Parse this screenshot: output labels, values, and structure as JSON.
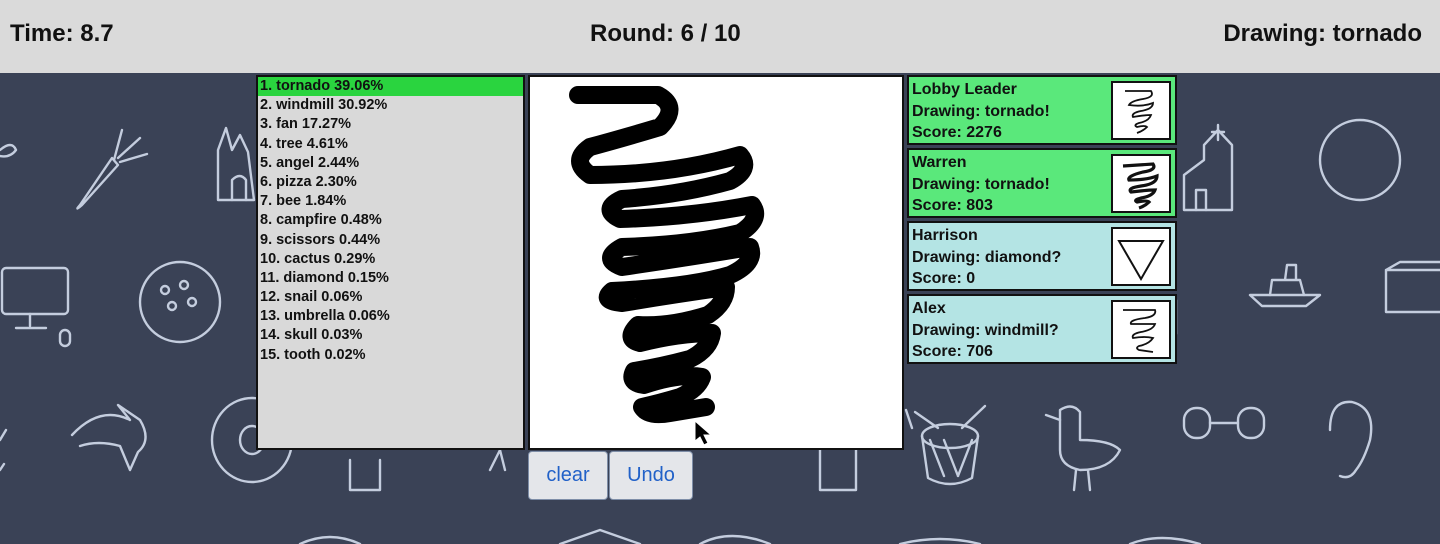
{
  "header": {
    "time_label": "Time: 8.7",
    "round_label": "Round: 6 / 10",
    "drawing_label": "Drawing: tornado"
  },
  "predictions": [
    "1. tornado 39.06%",
    "2. windmill 30.92%",
    "3. fan 17.27%",
    "4. tree 4.61%",
    "5. angel 2.44%",
    "6. pizza 2.30%",
    "7. bee 1.84%",
    "8. campfire 0.48%",
    "9. scissors 0.44%",
    "10. cactus 0.29%",
    "11. diamond 0.15%",
    "12. snail 0.06%",
    "13. umbrella 0.06%",
    "14. skull 0.03%",
    "15. tooth 0.02%"
  ],
  "controls": {
    "clear_label": "clear",
    "undo_label": "Undo"
  },
  "players": [
    {
      "name": "Lobby Leader",
      "status": "Drawing: tornado!",
      "score": "Score: 2276",
      "thumb_icon": "tornado-sketch-icon"
    },
    {
      "name": "Warren",
      "status": "Drawing: tornado!",
      "score": "Score: 803",
      "thumb_icon": "tornado-sketch-icon"
    },
    {
      "name": "Harrison",
      "status": "Drawing: diamond?",
      "score": "Score: 0",
      "thumb_icon": "triangle-sketch-icon"
    },
    {
      "name": "Alex",
      "status": "Drawing: windmill?",
      "score": "Score: 706",
      "thumb_icon": "squiggle-sketch-icon"
    }
  ],
  "colors": {
    "background": "#3a4256",
    "header": "#dadada",
    "top_prediction": "#2ad43f",
    "player_correct": "#5ae87b",
    "player_guessing": "#b4e4e4",
    "button_text": "#2161c8"
  }
}
